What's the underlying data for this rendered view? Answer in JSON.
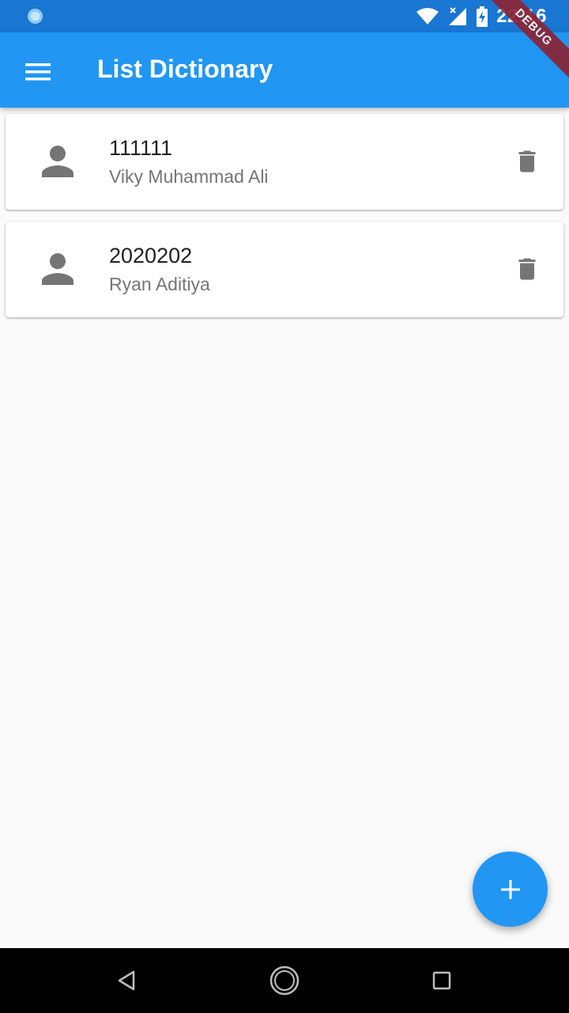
{
  "status_bar": {
    "time": "22:16",
    "debug_label": "DEBUG",
    "icons": [
      "notification-icon",
      "wifi-icon",
      "signal-icon",
      "battery-charging-icon"
    ]
  },
  "app_bar": {
    "title": "List Dictionary",
    "menu_icon": "menu-icon"
  },
  "items": [
    {
      "title": "111111",
      "subtitle": "Viky Muhammad Ali",
      "icon": "person-icon",
      "action_icon": "delete-icon"
    },
    {
      "title": "2020202",
      "subtitle": "Ryan Aditiya",
      "icon": "person-icon",
      "action_icon": "delete-icon"
    }
  ],
  "fab": {
    "icon": "add-icon"
  },
  "nav_bar": {
    "icons": [
      "back-icon",
      "home-icon",
      "recents-icon"
    ]
  },
  "colors": {
    "primary": "#2196f3",
    "primary_dark": "#1976d2",
    "icon_grey": "#757575",
    "debug_ribbon": "#8b2436"
  }
}
